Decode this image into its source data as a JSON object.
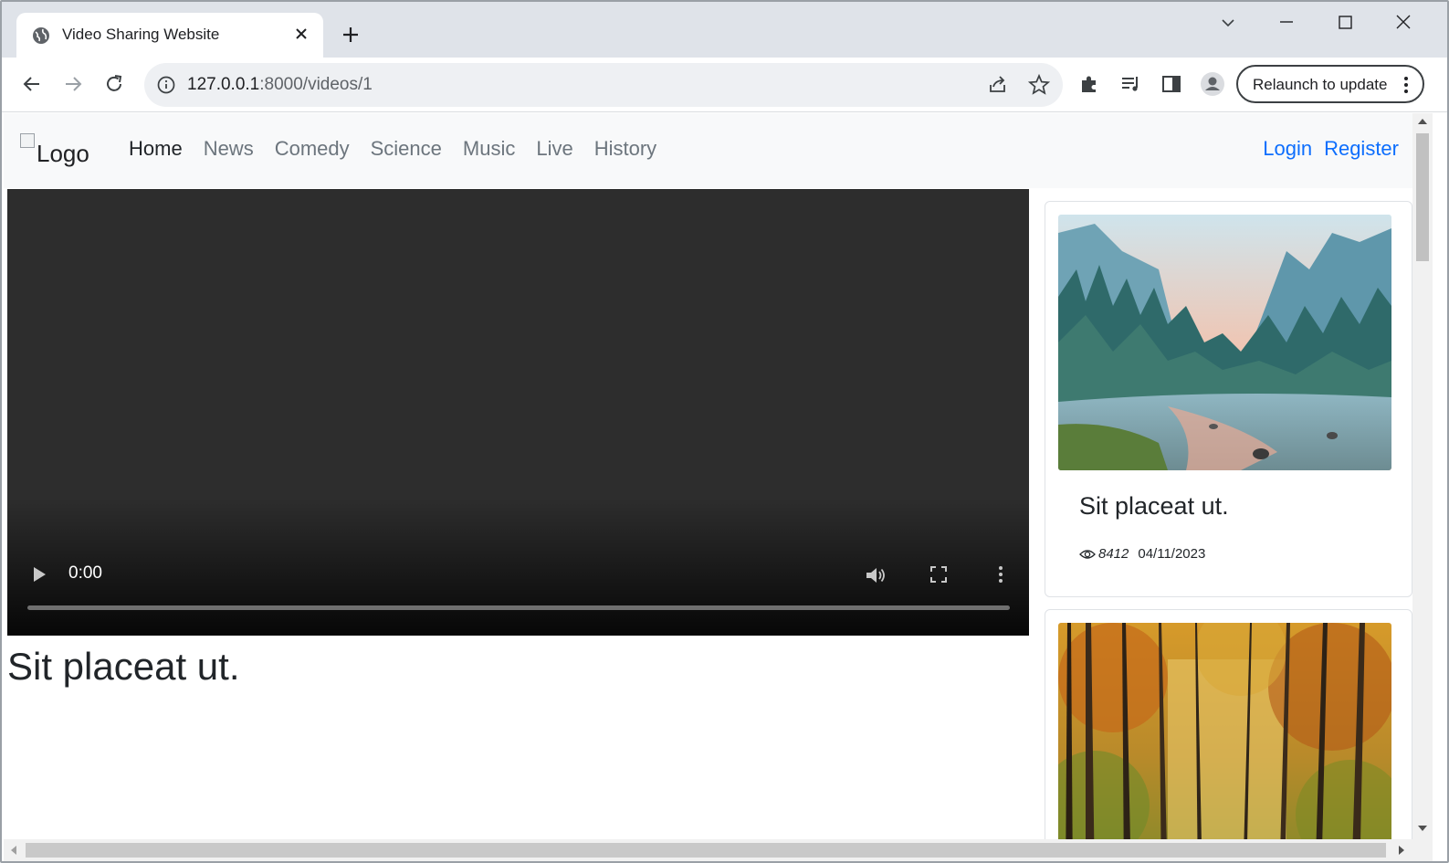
{
  "browser": {
    "tab_title": "Video Sharing Website",
    "url_host": "127.0.0.1",
    "url_path": ":8000/videos/1",
    "relaunch_label": "Relaunch to update"
  },
  "nav": {
    "logo_alt": "Logo",
    "links": [
      "Home",
      "News",
      "Comedy",
      "Science",
      "Music",
      "Live",
      "History"
    ],
    "active": "Home",
    "auth": [
      "Login",
      "Register"
    ]
  },
  "player": {
    "time": "0:00",
    "progress": 0
  },
  "video": {
    "title": "Sit placeat ut."
  },
  "sidebar": {
    "cards": [
      {
        "title": "Sit placeat ut.",
        "views": "8412",
        "date": "04/11/2023",
        "thumb": "mountain-river-landscape"
      },
      {
        "thumb": "autumn-forest"
      }
    ]
  },
  "colors": {
    "link_blue": "#0d6efd",
    "navbar_bg": "#f8f9fa",
    "player_bg": "#2d2d2d"
  }
}
